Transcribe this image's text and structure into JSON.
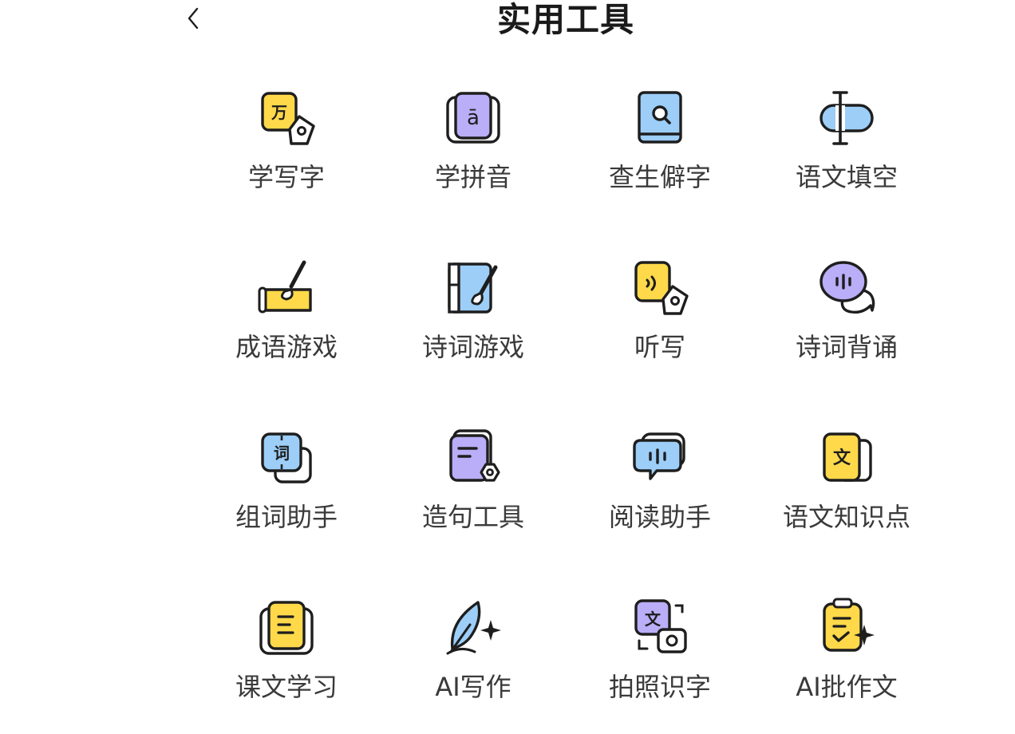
{
  "header": {
    "title": "实用工具",
    "back_icon": "chevron-left-icon"
  },
  "colors": {
    "yellow": "#FFD94A",
    "blue": "#8CC8F8",
    "purple": "#A99BF5",
    "stroke": "#1E1E1E"
  },
  "tools": [
    {
      "label": "学写字",
      "icon": "write-character-icon",
      "glyph": "万"
    },
    {
      "label": "学拼音",
      "icon": "pinyin-book-icon",
      "glyph": "ā"
    },
    {
      "label": "查生僻字",
      "icon": "search-book-icon"
    },
    {
      "label": "语文填空",
      "icon": "text-cursor-icon"
    },
    {
      "label": "成语游戏",
      "icon": "brush-scroll-icon"
    },
    {
      "label": "诗词游戏",
      "icon": "brush-notebook-icon"
    },
    {
      "label": "听写",
      "icon": "dictation-pen-icon"
    },
    {
      "label": "诗词背诵",
      "icon": "voice-chat-icon"
    },
    {
      "label": "组词助手",
      "icon": "word-card-icon",
      "glyph": "词"
    },
    {
      "label": "造句工具",
      "icon": "sentence-card-icon"
    },
    {
      "label": "阅读助手",
      "icon": "reading-audio-icon"
    },
    {
      "label": "语文知识点",
      "icon": "knowledge-card-icon",
      "glyph": "文"
    },
    {
      "label": "课文学习",
      "icon": "lesson-book-icon"
    },
    {
      "label": "AI写作",
      "icon": "quill-sparkle-icon"
    },
    {
      "label": "拍照识字",
      "icon": "photo-recognize-icon",
      "glyph": "文"
    },
    {
      "label": "AI批作文",
      "icon": "clipboard-check-icon"
    }
  ]
}
